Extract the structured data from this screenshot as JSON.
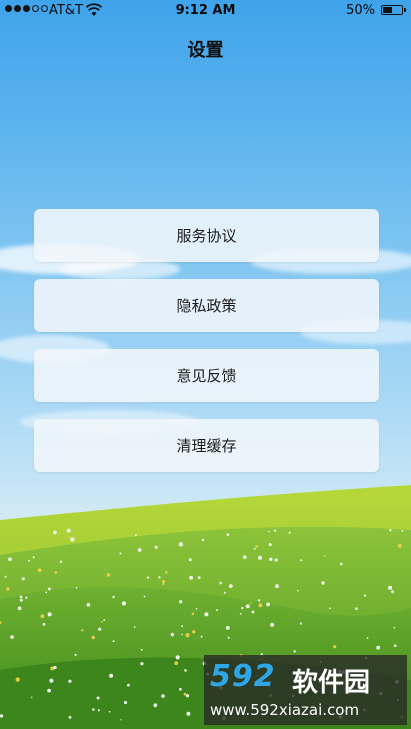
{
  "status_bar": {
    "carrier": "AT&T",
    "time": "9:12 AM",
    "battery": "50%",
    "battery_level": 0.5,
    "signal_bars_filled": 3,
    "signal_bars_total": 5
  },
  "header": {
    "title": "设置"
  },
  "menu": {
    "items": [
      {
        "label": "服务协议"
      },
      {
        "label": "隐私政策"
      },
      {
        "label": "意见反馈"
      },
      {
        "label": "清理缓存"
      }
    ]
  },
  "watermark": {
    "logo": "592",
    "name": "软件园",
    "url": "www.592xiazai.com"
  },
  "colors": {
    "sky_top": "#3fa3ea",
    "sky_bottom": "#d6ecf3",
    "grass": "#5fa32a",
    "card": "#f0f6fa",
    "watermark_accent": "#2fa6e6"
  }
}
